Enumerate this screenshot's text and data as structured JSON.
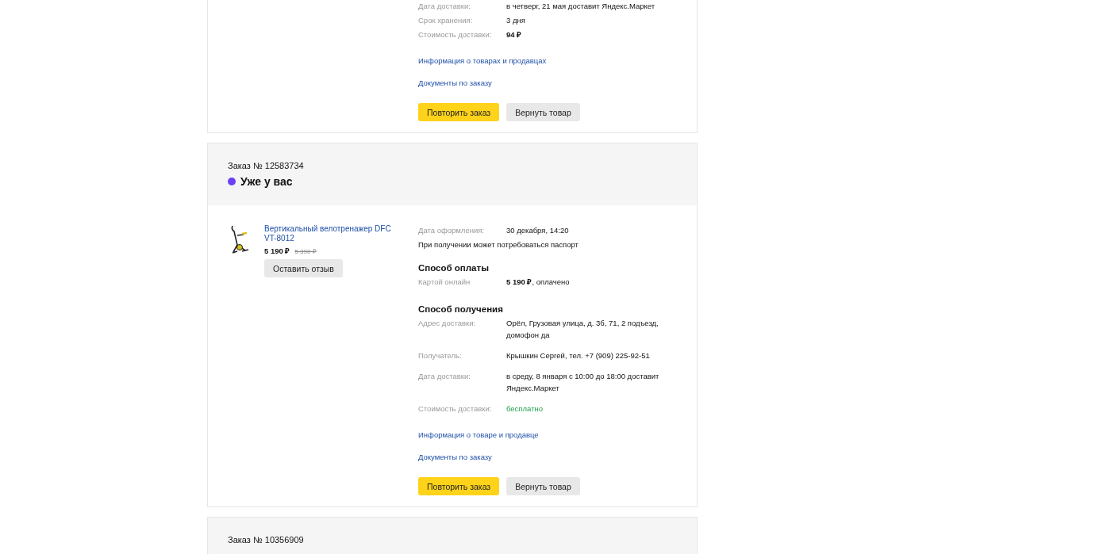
{
  "orders": [
    {
      "details": [
        {
          "kind": "row",
          "label": "Дата доставки:",
          "value": "в четверг, 21 мая доставит Яндекс.Маркет"
        },
        {
          "kind": "row",
          "label": "Срок хранения:",
          "value": "3 дня"
        },
        {
          "kind": "row",
          "label": "Стоимость доставки:",
          "value": "94 ₽",
          "bold": true
        }
      ],
      "links": [
        "Информация о товарах и продавцах",
        "Документы по заказу"
      ],
      "buttons": [
        {
          "label": "Повторить заказ",
          "primary": true
        },
        {
          "label": "Вернуть товар",
          "primary": false
        }
      ]
    },
    {
      "number": "Заказ № 12583734",
      "status": {
        "label": "Уже у вас",
        "color": "#6b3ff2"
      },
      "product": {
        "name": "Вертикальный велотренажер DFC VT-8012",
        "price": "5 190 ₽",
        "old_price": "5 390 ₽",
        "button": "Оставить отзыв"
      },
      "details": [
        {
          "kind": "row",
          "label": "Дата оформления:",
          "value": "30 декабря, 14:20"
        },
        {
          "kind": "note",
          "text": "При получении может потребоваться паспорт"
        },
        {
          "kind": "heading",
          "text": "Способ оплаты"
        },
        {
          "kind": "row",
          "label": "Картой онлайн",
          "value": "**5 190 ₽**, оплачено"
        },
        {
          "kind": "heading",
          "text": "Способ получения"
        },
        {
          "kind": "row",
          "label": "Адрес доставки:",
          "value": "Орёл, Грузовая улица, д. 3б, 71,  2 подъезд, домофон да"
        },
        {
          "kind": "row",
          "label": "Получатель:",
          "value": "Крышкин Сергей, тел. +7 (909) 225-92-51"
        },
        {
          "kind": "row",
          "label": "Дата доставки:",
          "value": "в среду, 8 января с 10:00 до 18:00 доставит Яндекс.Маркет"
        },
        {
          "kind": "row",
          "label": "Стоимость доставки:",
          "value": "бесплатно",
          "free": true
        }
      ],
      "links": [
        "Информация о товаре и продавце",
        "Документы по заказу"
      ],
      "buttons": [
        {
          "label": "Повторить заказ",
          "primary": true
        },
        {
          "label": "Вернуть товар",
          "primary": false
        }
      ]
    },
    {
      "number": "Заказ № 10356909"
    }
  ]
}
